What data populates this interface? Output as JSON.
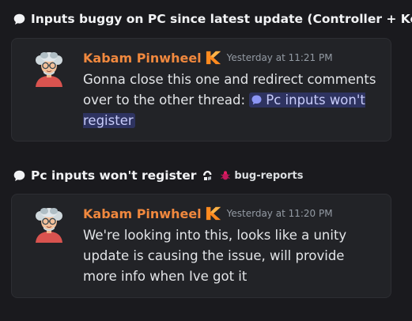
{
  "threads": [
    {
      "title": "Inputs buggy on PC since latest update (Controller + Ke",
      "message": {
        "author": "Kabam Pinwheel",
        "timestamp": "Yesterday at 11:21 PM",
        "text_before": "Gonna close this one and redirect comments over to the other thread: ",
        "mention": "Pc inputs won't register"
      }
    },
    {
      "title": "Pc inputs won't register",
      "channel": "bug-reports",
      "message": {
        "author": "Kabam Pinwheel",
        "timestamp": "Yesterday at 11:20 PM",
        "text": "We're looking into this, looks like a unity update is causing the issue, will provide more info when Ive got it"
      }
    }
  ],
  "icons": {
    "thread": "speech-bubble-icon",
    "badge": "kabam-k-icon",
    "stage": "stage-icon",
    "channel": "bug-icon"
  },
  "colors": {
    "background": "#1a1a1e",
    "card": "#222327",
    "author": "#f0883e",
    "mention_bg": "#2e3360",
    "mention_text": "#c9cdfb",
    "timestamp": "#949ba4"
  }
}
